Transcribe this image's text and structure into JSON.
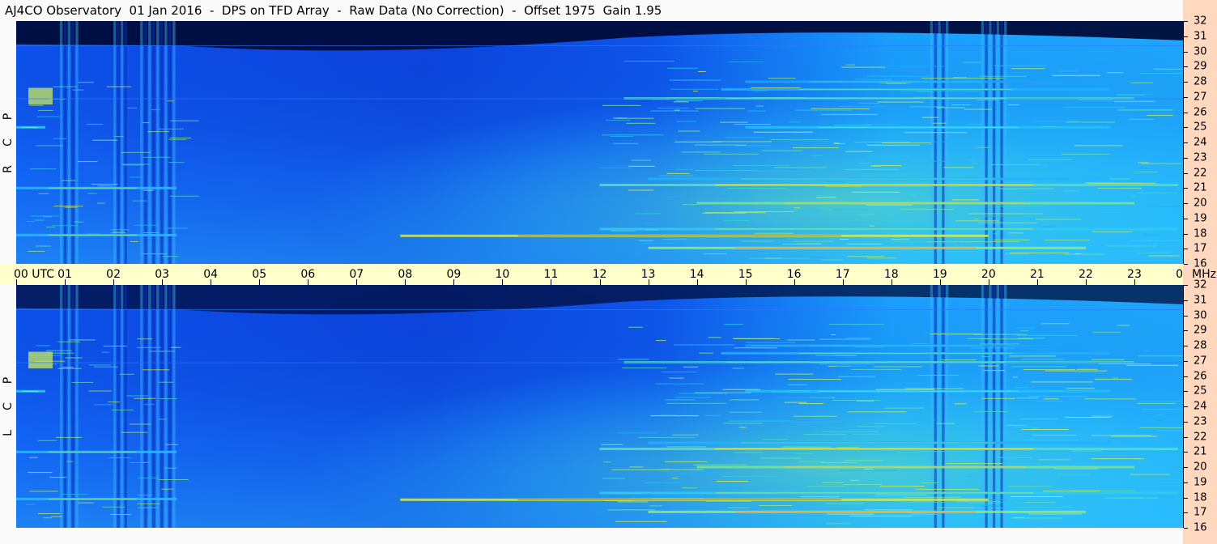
{
  "title": "AJ4CO Observatory  01 Jan 2016  -  DPS on TFD Array  -  Raw Data (No Correction)  -  Offset 1975  Gain 1.95",
  "colors": {
    "time_axis_bg": "#ffffcc",
    "freq_axis_bg": "#ffd8bf",
    "colormap": [
      "#000c3a",
      "#0a3ed8",
      "#1f8cff",
      "#22c9ff",
      "#7fe68f",
      "#f0ec3a",
      "#ff5a1a",
      "#d61a78"
    ]
  },
  "chart_data": {
    "type": "heatmap",
    "title": "AJ4CO Observatory  01 Jan 2016  -  DPS on TFD Array  -  Raw Data (No Correction)  -  Offset 1975  Gain 1.95",
    "x_axis": {
      "range": [
        0,
        24
      ],
      "ticks": [
        "00",
        "01",
        "02",
        "03",
        "04",
        "05",
        "06",
        "07",
        "08",
        "09",
        "10",
        "11",
        "12",
        "13",
        "14",
        "15",
        "16",
        "17",
        "18",
        "19",
        "20",
        "21",
        "22",
        "23",
        "00"
      ],
      "first_label_suffix": "UTC"
    },
    "y_axis": {
      "range": [
        16,
        32
      ],
      "unit": "MHz",
      "ticks": [
        32,
        31,
        30,
        29,
        28,
        27,
        26,
        25,
        24,
        23,
        22,
        21,
        20,
        19,
        18,
        17,
        16
      ]
    },
    "panels": [
      {
        "name": "R C P",
        "letters": [
          "R",
          "C",
          "P"
        ]
      },
      {
        "name": "L C P",
        "letters": [
          "L",
          "C",
          "P"
        ]
      }
    ],
    "features": {
      "vertical_interference_utc": [
        [
          0.9,
          1.3
        ],
        [
          2.0,
          2.3
        ],
        [
          2.55,
          3.3
        ],
        [
          18.8,
          19.2
        ],
        [
          19.85,
          20.4
        ]
      ],
      "strong_bands_mhz": [
        {
          "freq": 17.85,
          "start": 7.9,
          "end": 20.0,
          "intensity": 0.9
        },
        {
          "freq": 17.05,
          "start": 13.0,
          "end": 22.0,
          "intensity": 0.8
        },
        {
          "freq": 18.3,
          "start": 12.0,
          "end": 23.9,
          "intensity": 0.6
        },
        {
          "freq": 21.2,
          "start": 12.0,
          "end": 23.9,
          "intensity": 0.7
        },
        {
          "freq": 21.6,
          "start": 13.0,
          "end": 22.5,
          "intensity": 0.5
        },
        {
          "freq": 20.0,
          "start": 14.0,
          "end": 23.0,
          "intensity": 0.75
        },
        {
          "freq": 25.0,
          "start": 15.0,
          "end": 22.5,
          "intensity": 0.55
        },
        {
          "freq": 26.9,
          "start": 12.5,
          "end": 23.0,
          "intensity": 0.65
        },
        {
          "freq": 27.5,
          "start": 14.5,
          "end": 22.5,
          "intensity": 0.5
        },
        {
          "freq": 28.0,
          "start": 15.0,
          "end": 21.5,
          "intensity": 0.45
        },
        {
          "freq": 25.0,
          "start": 0.0,
          "end": 0.6,
          "intensity": 0.6
        },
        {
          "freq": 21.0,
          "start": 0.0,
          "end": 3.3,
          "intensity": 0.55
        },
        {
          "freq": 17.9,
          "start": 0.0,
          "end": 3.3,
          "intensity": 0.55
        }
      ],
      "dark_region_top_mhz": 30.3
    }
  }
}
